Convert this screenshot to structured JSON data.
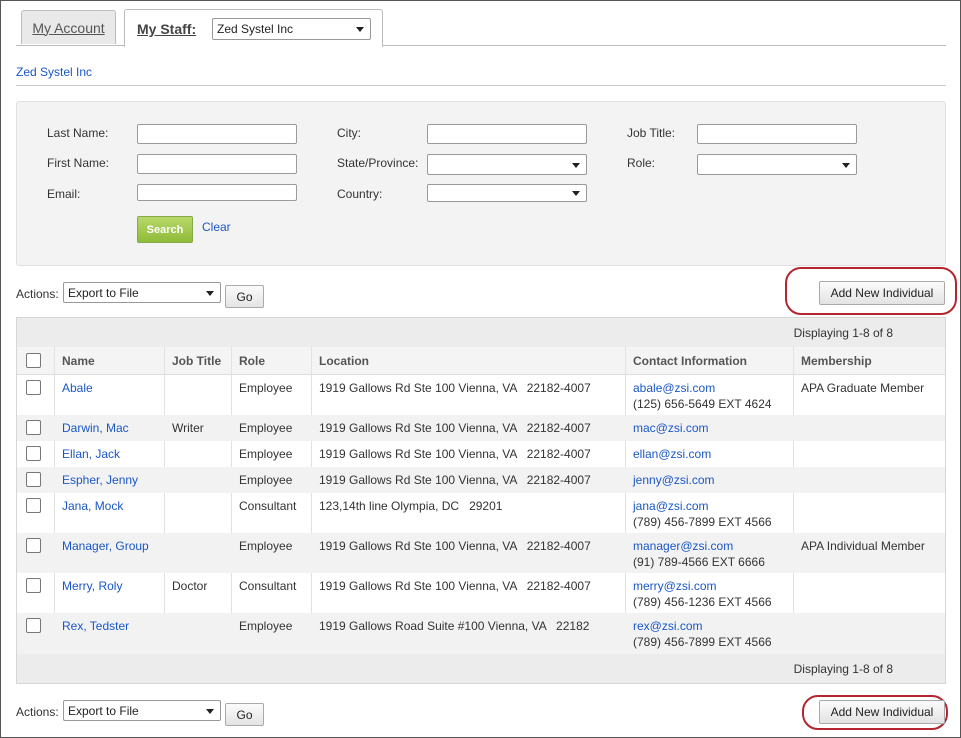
{
  "tabs": {
    "my_account": "My Account",
    "my_staff": "My Staff:",
    "org_select_value": "Zed Systel Inc"
  },
  "org_link": "Zed Systel Inc",
  "search": {
    "last_name_label": "Last Name:",
    "first_name_label": "First Name:",
    "email_label": "Email:",
    "city_label": "City:",
    "state_label": "State/Province:",
    "country_label": "Country:",
    "job_title_label": "Job Title:",
    "role_label": "Role:",
    "search_button": "Search",
    "clear_link": "Clear"
  },
  "actions": {
    "label": "Actions:",
    "select_value": "Export to File",
    "go_button": "Go",
    "add_button": "Add New Individual"
  },
  "table": {
    "displaying": "Displaying 1-8 of 8",
    "columns": {
      "name": "Name",
      "job_title": "Job Title",
      "role": "Role",
      "location": "Location",
      "contact": "Contact Information",
      "membership": "Membership"
    },
    "rows": [
      {
        "name": "Abale",
        "job_title": "",
        "role": "Employee",
        "location": "1919 Gallows Rd Ste 100 Vienna, VA   22182-4007",
        "email": "abale@zsi.com",
        "phone": "(125) 656-5649 EXT 4624",
        "membership": "APA Graduate Member"
      },
      {
        "name": "Darwin, Mac",
        "job_title": "Writer",
        "role": "Employee",
        "location": "1919 Gallows Rd Ste 100 Vienna, VA   22182-4007",
        "email": "mac@zsi.com",
        "phone": "",
        "membership": ""
      },
      {
        "name": "Ellan, Jack",
        "job_title": "",
        "role": "Employee",
        "location": "1919 Gallows Rd Ste 100 Vienna, VA   22182-4007",
        "email": "ellan@zsi.com",
        "phone": "",
        "membership": ""
      },
      {
        "name": "Espher, Jenny",
        "job_title": "",
        "role": "Employee",
        "location": "1919 Gallows Rd Ste 100 Vienna, VA   22182-4007",
        "email": "jenny@zsi.com",
        "phone": "",
        "membership": ""
      },
      {
        "name": "Jana, Mock",
        "job_title": "",
        "role": "Consultant",
        "location": "123,14th line Olympia, DC   29201",
        "email": "jana@zsi.com",
        "phone": "(789) 456-7899 EXT 4566",
        "membership": ""
      },
      {
        "name": "Manager, Group",
        "job_title": "",
        "role": "Employee",
        "location": "1919 Gallows Rd Ste 100 Vienna, VA   22182-4007",
        "email": "manager@zsi.com",
        "phone": "(91) 789-4566 EXT 6666",
        "membership": "APA Individual Member"
      },
      {
        "name": "Merry, Roly",
        "job_title": "Doctor",
        "role": "Consultant",
        "location": "1919 Gallows Rd Ste 100 Vienna, VA   22182-4007",
        "email": "merry@zsi.com",
        "phone": "(789) 456-1236 EXT 4566",
        "membership": ""
      },
      {
        "name": "Rex, Tedster",
        "job_title": "",
        "role": "Employee",
        "location": "1919 Gallows Road Suite #100 Vienna, VA   22182",
        "email": "rex@zsi.com",
        "phone": "(789) 456-7899 EXT 4566",
        "membership": ""
      }
    ]
  }
}
